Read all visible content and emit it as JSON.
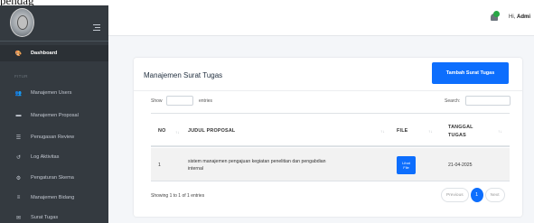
{
  "top_fragment": "pendag",
  "sidebar": {
    "section_header": "FITUR",
    "items": [
      {
        "label": "Dashboard",
        "icon": "palette-icon",
        "glyph": "🎨",
        "active": true
      },
      {
        "label": "Manajemen Users",
        "icon": "users-icon",
        "glyph": "👥"
      },
      {
        "label": "Manajemen Proposal",
        "icon": "folder-icon",
        "glyph": "▬"
      },
      {
        "label": "Penugasan Review",
        "icon": "list-icon",
        "glyph": "☰"
      },
      {
        "label": "Log Aktivitas",
        "icon": "history-icon",
        "glyph": "↺"
      },
      {
        "label": "Pengaturan Skema",
        "icon": "cogs-icon",
        "glyph": "⚙"
      },
      {
        "label": "Manajemen Bidang",
        "icon": "database-icon",
        "glyph": "≡"
      },
      {
        "label": "Surat Tugas",
        "icon": "envelope-icon",
        "glyph": "✉"
      }
    ]
  },
  "topbar": {
    "greeting_prefix": "Hi, ",
    "user_name": "Admi",
    "notification_color": "#28a745"
  },
  "card": {
    "title": "Manajemen Surat Tugas",
    "add_button": "Tambah Surat Tugas",
    "show_label": "Show",
    "entries_label": "entries",
    "search_label": "Search:",
    "search_placeholder": ""
  },
  "table": {
    "headers": {
      "no": "NO",
      "judul": "JUDUL PROPOSAL",
      "file": "FILE",
      "tanggal_1": "TANGGAL",
      "tanggal_2": "TUGAS"
    },
    "rows": [
      {
        "no": "1",
        "judul_1": "sistem manajemen pengajuan kegiatan penelitian dan pengabdian",
        "judul_2": "internal",
        "file_btn_1": "Lihat",
        "file_btn_2": "File",
        "tanggal": "21-04-2025"
      }
    ]
  },
  "footer": {
    "info": "Showing 1 to 1 of 1 entries",
    "previous": "Previous",
    "current_page": "1",
    "next": "Next"
  },
  "colors": {
    "sidebar_bg": "#343a40",
    "primary": "#0d6efd",
    "content_bg": "#f4f6f9"
  }
}
